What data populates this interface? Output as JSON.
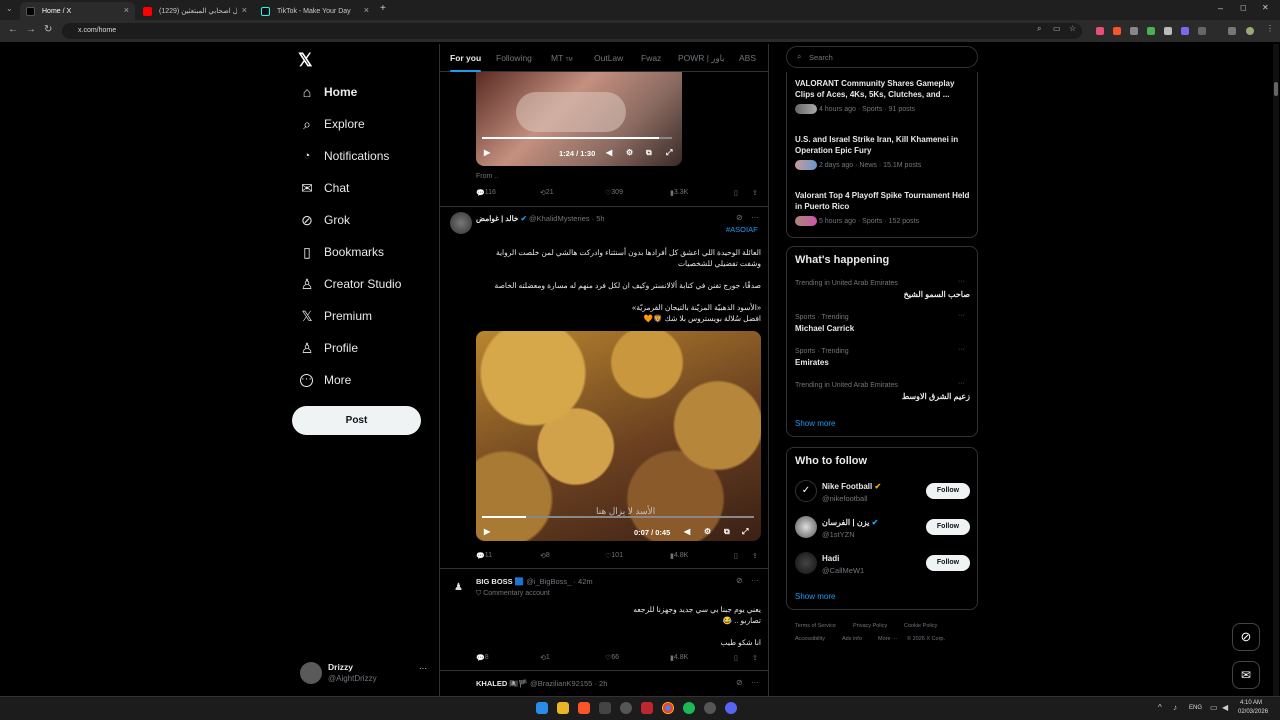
{
  "browser": {
    "tabs": [
      {
        "title": "Home / X",
        "color": "#1f1f1f"
      },
      {
        "title": "قنابل اصحابي المبتعثين (1229) ..",
        "color": "#ff0000"
      },
      {
        "title": "TikTok - Make Your Day",
        "color": "#25f4ee"
      }
    ],
    "url": "x.com/home",
    "window_min": "–",
    "window_max": "◻",
    "window_close": "✕"
  },
  "nav": {
    "logo": "𝕏",
    "items": [
      {
        "label": "Home",
        "icon": "home-icon",
        "glyph": "⌂"
      },
      {
        "label": "Explore",
        "icon": "search-icon",
        "glyph": "⌕"
      },
      {
        "label": "Notifications",
        "icon": "bell-icon",
        "glyph": "🔔"
      },
      {
        "label": "Chat",
        "icon": "mail-icon",
        "glyph": "✉"
      },
      {
        "label": "Grok",
        "icon": "grok-icon",
        "glyph": "⊘"
      },
      {
        "label": "Bookmarks",
        "icon": "bookmark-icon",
        "glyph": "▯"
      },
      {
        "label": "Creator Studio",
        "icon": "creator-icon",
        "glyph": "♙"
      },
      {
        "label": "Premium",
        "icon": "x-icon",
        "glyph": "𝕏"
      },
      {
        "label": "Profile",
        "icon": "person-icon",
        "glyph": "♙"
      },
      {
        "label": "More",
        "icon": "more-circle-icon",
        "glyph": "⋯"
      }
    ],
    "post_label": "Post",
    "account": {
      "name": "Drizzy",
      "handle": "@AightDrizzy",
      "more": "···"
    }
  },
  "feed": {
    "tabs": [
      "For you",
      "Following",
      "MT",
      "OutLaw",
      "Fwaz",
      "POWR | باور",
      "ABS"
    ],
    "tab_badge": "TM",
    "tweet0": {
      "video_time": "1:24 / 1:30",
      "from": "From ..",
      "replies": "116",
      "reposts": "21",
      "likes": "309",
      "views": "3.3K"
    },
    "tweet1": {
      "name": "خالد | غوامض",
      "handle": "@KhalidMysteries",
      "time": "· 5h",
      "hashtag": "#ASOIAF",
      "lines": [
        "العائلة الوحيدة اللي اعشق كل أفرادها بدون أستثناء وادركت هالشي لمن خلصت الرواية",
        "وشفت تفضيلي للشخصيات",
        "صدقًا، جورج تفنن في كتابة ألالانستر وكيف ان لكل فرد منهم له مسارة ومعضلته الخاصة",
        "«الأسود الذهبيّة المزيّنة بالتيجان القرمزيّة»",
        "افضل سُلالة بويستروس بلا شك 🦁🧡"
      ],
      "video_caption": "الأسد لا يزال هنا",
      "video_time": "0:07 / 0:45",
      "replies": "11",
      "reposts": "8",
      "likes": "101",
      "views": "4.8K"
    },
    "tweet2": {
      "name": "BIG BOSS 🟦",
      "handle": "@i_BigBoss_",
      "time": "· 42m",
      "label": "Commentary account",
      "lines": [
        "يعني يوم جبنا بي سي جديد وجهزنا للرجعه",
        "تصاربو .. 😂",
        "انا شكو طيب"
      ],
      "replies": "8",
      "reposts": "1",
      "likes": "66",
      "views": "4.8K"
    },
    "tweet3": {
      "name": "KHALED 🏴‍☠️🏴",
      "handle": "@BrazilianK92155",
      "time": "· 2h"
    }
  },
  "right": {
    "search_placeholder": "Search",
    "news": [
      {
        "title": "VALORANT Community Shares Gameplay Clips of Aces, 4Ks, 5Ks, Clutches, and ...",
        "meta": "4 hours ago · Sports · 91 posts"
      },
      {
        "title": "U.S. and Israel Strike Iran, Kill Khamenei in Operation Epic Fury",
        "meta": "2 days ago · News · 15.1M posts"
      },
      {
        "title": "Valorant Top 4 Playoff Spike Tournament Held in Puerto Rico",
        "meta": "5 hours ago · Sports · 152 posts"
      }
    ],
    "happening_title": "What's happening",
    "trends": [
      {
        "context": "Trending in United Arab Emirates",
        "name": "صاحب السمو الشيخ",
        "rtl": true
      },
      {
        "context": "Sports · Trending",
        "name": "Michael Carrick",
        "rtl": false
      },
      {
        "context": "Sports · Trending",
        "name": "Emirates",
        "rtl": false
      },
      {
        "context": "Trending in United Arab Emirates",
        "name": "زعيم الشرق الاوسط",
        "rtl": true
      }
    ],
    "show_more": "Show more",
    "follow_title": "Who to follow",
    "follow": [
      {
        "name": "Nike Football",
        "handle": "@nikefootball",
        "button": "Follow"
      },
      {
        "name": "يزن | الفرسان",
        "handle": "@1stYZN",
        "button": "Follow"
      },
      {
        "name": "Hadi",
        "handle": "@CallMeW1",
        "button": "Follow"
      }
    ],
    "footer": [
      "Terms of Service",
      "Privacy Policy",
      "Cookie Policy",
      "Accessibility",
      "Ads info",
      "More ···",
      "© 2026 X Corp."
    ]
  },
  "taskbar": {
    "lang": "ENG",
    "time": "4:10 AM",
    "date": "02/03/2026"
  },
  "colors": {
    "accent": "#1d9bf0",
    "bg": "#000000",
    "border": "#2f3336"
  }
}
